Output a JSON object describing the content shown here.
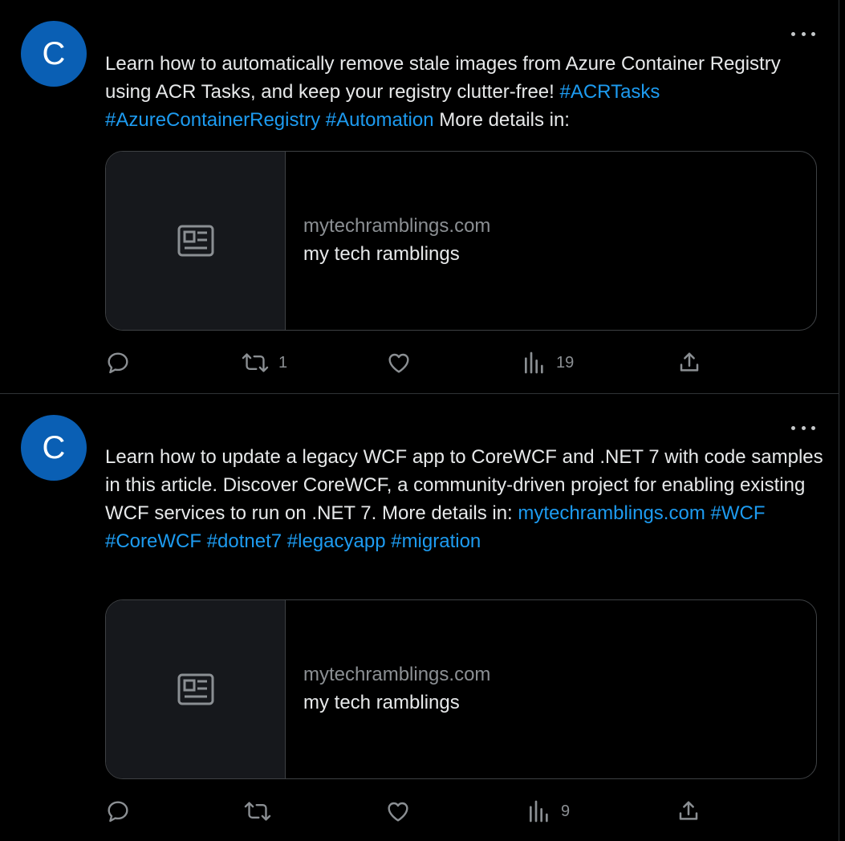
{
  "tweets": [
    {
      "avatar_letter": "C",
      "text_segments": [
        {
          "text": "Learn how to automatically remove stale images from Azure Container Registry using ACR Tasks, and keep your registry clutter-free! ",
          "link": false
        },
        {
          "text": "#ACRTasks",
          "link": true
        },
        {
          "text": " ",
          "link": false
        },
        {
          "text": "#AzureContainerRegistry",
          "link": true
        },
        {
          "text": " ",
          "link": false
        },
        {
          "text": "#Automation",
          "link": true
        },
        {
          "text": " More details in:",
          "link": false
        }
      ],
      "card": {
        "domain": "mytechramblings.com",
        "title": "my tech ramblings"
      },
      "actions": {
        "replies": "",
        "retweets": "1",
        "likes": "",
        "views": "19"
      }
    },
    {
      "avatar_letter": "C",
      "text_segments": [
        {
          "text": "Learn how to update a legacy WCF app to CoreWCF and .NET 7 with code samples in this article. Discover CoreWCF, a community-driven project for enabling existing WCF services to run on .NET 7. More details in: ",
          "link": false
        },
        {
          "text": "mytechramblings.com",
          "link": true
        },
        {
          "text": " ",
          "link": false
        },
        {
          "text": "#WCF",
          "link": true
        },
        {
          "text": " ",
          "link": false
        },
        {
          "text": "#CoreWCF",
          "link": true
        },
        {
          "text": " ",
          "link": false
        },
        {
          "text": "#dotnet7",
          "link": true
        },
        {
          "text": " ",
          "link": false
        },
        {
          "text": "#legacyapp",
          "link": true
        },
        {
          "text": " ",
          "link": false
        },
        {
          "text": "#migration",
          "link": true
        }
      ],
      "card": {
        "domain": "mytechramblings.com",
        "title": "my tech ramblings"
      },
      "actions": {
        "replies": "",
        "retweets": "",
        "likes": "",
        "views": "9"
      }
    }
  ],
  "icons": {
    "more": "more-horizontal-icon",
    "card_placeholder": "article-icon",
    "reply": "reply-icon",
    "retweet": "retweet-icon",
    "like": "heart-icon",
    "views": "views-icon",
    "share": "share-icon"
  },
  "colors": {
    "background": "#000000",
    "link": "#1d9bf0",
    "avatar": "#0a5fb4",
    "muted": "#8b8f93"
  }
}
